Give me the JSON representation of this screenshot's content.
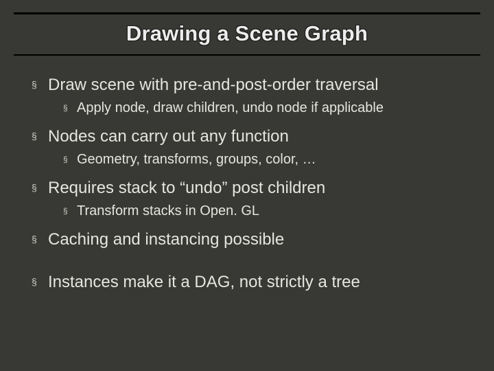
{
  "title": "Drawing a Scene Graph",
  "bullets": [
    {
      "level": 1,
      "text": "Draw scene with pre-and-post-order traversal"
    },
    {
      "level": 2,
      "text": "Apply node, draw children, undo node if applicable"
    },
    {
      "level": 1,
      "text": "Nodes can carry out any function"
    },
    {
      "level": 2,
      "text": "Geometry, transforms, groups, color, …"
    },
    {
      "level": 1,
      "text": "Requires stack to “undo” post children"
    },
    {
      "level": 2,
      "text": "Transform stacks in Open. GL"
    },
    {
      "level": 1,
      "text": "Caching and instancing possible"
    },
    {
      "level": 1,
      "text": "Instances make it a DAG, not strictly a tree"
    }
  ]
}
